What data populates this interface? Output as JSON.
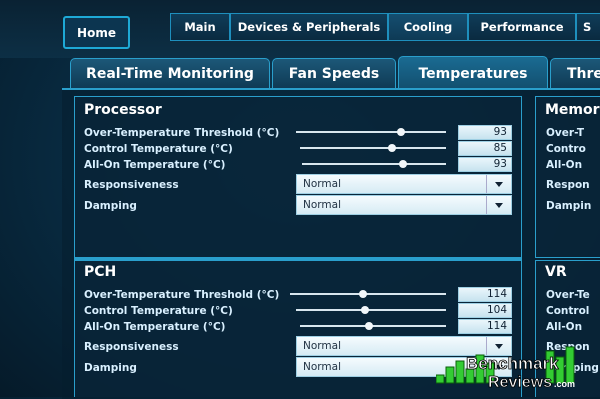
{
  "topnav": {
    "home": "Home",
    "tabs": [
      {
        "label": "Main"
      },
      {
        "label": "Devices & Peripherals"
      },
      {
        "label": "Cooling"
      },
      {
        "label": "Performance"
      },
      {
        "label": "S"
      }
    ],
    "active_tab": "Cooling"
  },
  "subtabs": [
    {
      "label": "Real-Time Monitoring"
    },
    {
      "label": "Fan Speeds"
    },
    {
      "label": "Temperatures"
    },
    {
      "label": "Thre"
    }
  ],
  "active_subtab": "Temperatures",
  "panels": {
    "processor": {
      "title": "Processor",
      "rows": [
        {
          "label": "Over-Temperature Threshold (°C)",
          "value": "93"
        },
        {
          "label": "Control Temperature (°C)",
          "value": "85"
        },
        {
          "label": "All-On Temperature (°C)",
          "value": "93"
        }
      ],
      "responsiveness_label": "Responsiveness",
      "responsiveness_value": "Normal",
      "damping_label": "Damping",
      "damping_value": "Normal"
    },
    "pch": {
      "title": "PCH",
      "rows": [
        {
          "label": "Over-Temperature Threshold (°C)",
          "value": "114"
        },
        {
          "label": "Control Temperature (°C)",
          "value": "104"
        },
        {
          "label": "All-On Temperature (°C)",
          "value": "114"
        }
      ],
      "responsiveness_label": "Responsiveness",
      "responsiveness_value": "Normal",
      "damping_label": "Damping",
      "damping_value": "Normal"
    },
    "memory": {
      "title": "Memor",
      "rows": [
        "Over-T",
        "Contro",
        "All-On",
        "Respon",
        "Dampin"
      ]
    },
    "vr": {
      "title": "VR",
      "rows": [
        "Over-Te",
        "Control",
        "All-On",
        "Respon",
        "Damping"
      ]
    }
  },
  "watermark": {
    "line1": "Benchmark",
    "line2": "Reviews",
    "suffix": ".com"
  },
  "colors": {
    "accent": "#2ab4e6",
    "panel_border": "#2a9fcc",
    "background": "#082a40"
  }
}
